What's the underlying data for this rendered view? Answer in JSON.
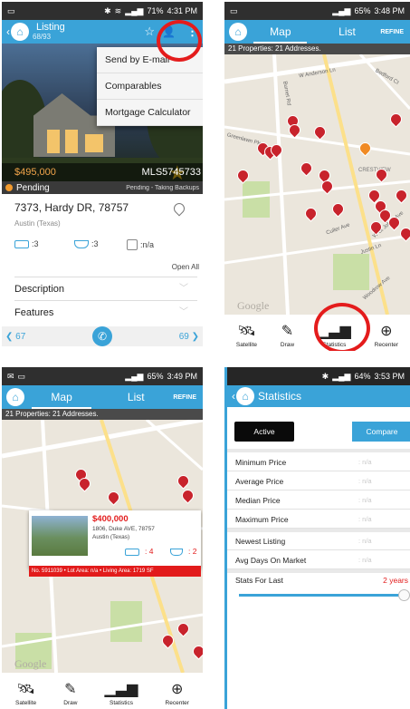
{
  "listing": {
    "status_time": "4:31 PM",
    "title": "Listing",
    "counter": "68/93",
    "menu": [
      "Send by E-mail",
      "Comparables",
      "Mortgage Calculator"
    ],
    "price": "$495,000",
    "mls": "MLS5745733",
    "status": "Pending",
    "status_detail": "Pending - Taking Backups",
    "address": "7373, Hardy DR, 78757",
    "city": "Austin (Texas)",
    "beds": ":3",
    "baths": ":3",
    "area": ":n/a",
    "open_all": "Open All",
    "sections": [
      "Description",
      "Features"
    ],
    "prev": "67",
    "next": "69"
  },
  "map1": {
    "status_time": "3:48 PM",
    "battery": "65%",
    "tabs": [
      "Map",
      "List"
    ],
    "refine": "REFINE",
    "subtitle": "21 Properties: 21 Addresses.",
    "streets": [
      "W Anderson Ln",
      "Burnet Rd",
      "Greenlawn Pkwy",
      "CRESTVIEW",
      "Culler Ave",
      "Justin Ln",
      "W St Johns Ave",
      "Woodrow Ave",
      "Bedford Ct"
    ],
    "tools": [
      "Satellite",
      "Draw",
      "Statistics",
      "Recenter"
    ]
  },
  "map2": {
    "status_time": "3:49 PM",
    "battery": "65%",
    "tabs": [
      "Map",
      "List"
    ],
    "refine": "REFINE",
    "subtitle": "21 Properties: 21 Addresses.",
    "popup_price": "$400,000",
    "popup_address": "1806, Duke AVE, 78757",
    "popup_city": "Austin (Texas)",
    "popup_beds": ": 4",
    "popup_baths": ": 2",
    "popup_bar": "No. 5911039 • Lot Area: n/a • Living Area: 1719 SF",
    "tools": [
      "Satellite",
      "Draw",
      "Statistics",
      "Recenter"
    ]
  },
  "stats": {
    "status_time": "3:53 PM",
    "battery": "64%",
    "title": "Statistics",
    "active": "Active",
    "compare": "Compare",
    "rows": [
      {
        "label": "Minimum Price",
        "value": ": n/a"
      },
      {
        "label": "Average Price",
        "value": ": n/a"
      },
      {
        "label": "Median Price",
        "value": ": n/a"
      },
      {
        "label": "Maximum Price",
        "value": ": n/a"
      },
      {
        "label": "Newest Listing",
        "value": ": n/a"
      },
      {
        "label": "Avg Days On Market",
        "value": ": n/a"
      }
    ],
    "stats_for_last": "Stats For Last",
    "years": "2 years",
    "slider_fraction": 1.0
  },
  "colors": {
    "accent": "#3aa3d8",
    "pin": "#c8232c",
    "highlight": "#e41c1c"
  }
}
